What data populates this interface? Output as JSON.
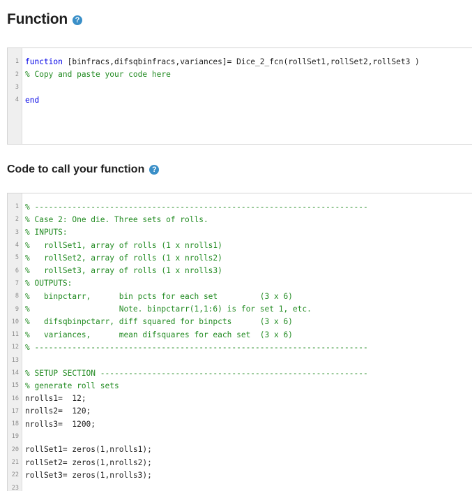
{
  "function_section": {
    "title": "Function",
    "help_icon": "question-circle-icon",
    "code_lines": [
      {
        "n": "1",
        "kw": "function",
        "rest": " [binfracs,difsqbinfracs,variances]= Dice_2_fcn(rollSet1,rollSet2,rollSet3 )"
      },
      {
        "n": "2",
        "text": "% Copy and paste your code here"
      },
      {
        "n": "3",
        "text": ""
      },
      {
        "n": "4",
        "kw": "end",
        "rest": ""
      }
    ]
  },
  "call_section": {
    "title": "Code to call your function",
    "help_icon": "question-circle-icon",
    "code_lines": [
      {
        "n": "1",
        "text": "% -----------------------------------------------------------------------"
      },
      {
        "n": "2",
        "text": "% Case 2: One die. Three sets of rolls."
      },
      {
        "n": "3",
        "text": "% INPUTS:"
      },
      {
        "n": "4",
        "text": "%   rollSet1, array of rolls (1 x nrolls1)"
      },
      {
        "n": "5",
        "text": "%   rollSet2, array of rolls (1 x nrolls2)"
      },
      {
        "n": "6",
        "text": "%   rollSet3, array of rolls (1 x nrolls3)"
      },
      {
        "n": "7",
        "text": "% OUTPUTS:"
      },
      {
        "n": "8",
        "text": "%   binpctarr,      bin pcts for each set         (3 x 6)"
      },
      {
        "n": "9",
        "text": "%                   Note. binpctarr(1,1:6) is for set 1, etc."
      },
      {
        "n": "10",
        "text": "%   difsqbinpctarr, diff squared for binpcts      (3 x 6)"
      },
      {
        "n": "11",
        "text": "%   variances,      mean difsquares for each set  (3 x 6)"
      },
      {
        "n": "12",
        "text": "% -----------------------------------------------------------------------"
      },
      {
        "n": "13",
        "text": ""
      },
      {
        "n": "14",
        "text": "% SETUP SECTION ---------------------------------------------------------"
      },
      {
        "n": "15",
        "text": "% generate roll sets"
      },
      {
        "n": "16",
        "text": "nrolls1=  12;"
      },
      {
        "n": "17",
        "text": "nrolls2=  120;"
      },
      {
        "n": "18",
        "text": "nrolls3=  1200;"
      },
      {
        "n": "19",
        "text": ""
      },
      {
        "n": "20",
        "text": "rollSet1= zeros(1,nrolls1);"
      },
      {
        "n": "21",
        "text": "rollSet2= zeros(1,nrolls2);"
      },
      {
        "n": "22",
        "text": "rollSet3= zeros(1,nrolls3);"
      },
      {
        "n": "23",
        "text": ""
      }
    ]
  }
}
